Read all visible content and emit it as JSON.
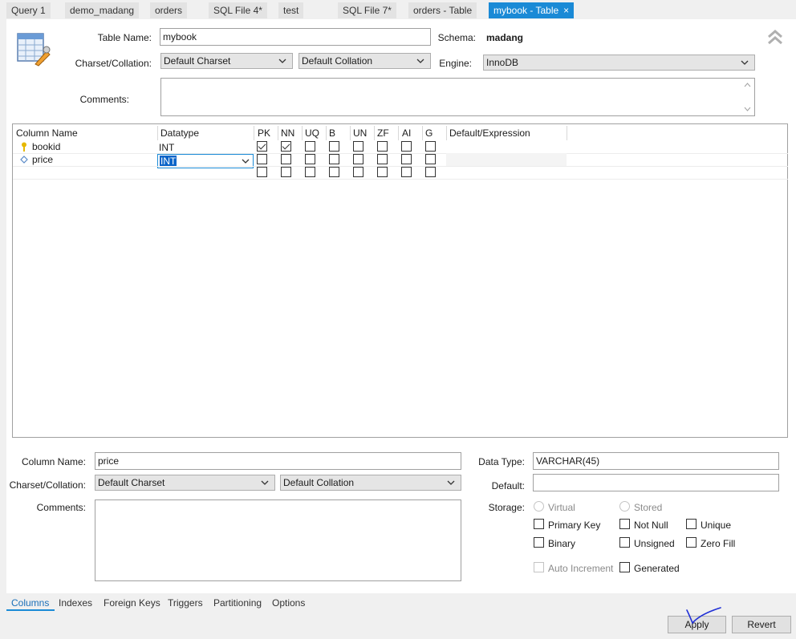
{
  "tabs": [
    {
      "label": "Query 1"
    },
    {
      "label": "demo_madang"
    },
    {
      "label": "orders"
    },
    {
      "label": "SQL File 4*"
    },
    {
      "label": "test"
    },
    {
      "label": "SQL File 7*"
    },
    {
      "label": "orders - Table"
    },
    {
      "label": "mybook - Table",
      "active": true
    }
  ],
  "table": {
    "name_label": "Table Name:",
    "name_value": "mybook",
    "schema_label": "Schema:",
    "schema_value": "madang",
    "charset_label": "Charset/Collation:",
    "charset_value": "Default Charset",
    "collation_value": "Default Collation",
    "engine_label": "Engine:",
    "engine_value": "InnoDB",
    "comments_label": "Comments:"
  },
  "grid": {
    "headers": [
      "Column Name",
      "Datatype",
      "PK",
      "NN",
      "UQ",
      "B",
      "UN",
      "ZF",
      "AI",
      "G",
      "Default/Expression"
    ],
    "rows": [
      {
        "name": "bookid",
        "type": "INT",
        "pk": true,
        "nn": true
      },
      {
        "name": "price",
        "type": "INT",
        "pk": false,
        "nn": false
      }
    ]
  },
  "column": {
    "name_label": "Column Name:",
    "name_value": "price",
    "charset_label": "Charset/Collation:",
    "charset_value": "Default Charset",
    "collation_value": "Default Collation",
    "comments_label": "Comments:",
    "datatype_label": "Data Type:",
    "datatype_value": "VARCHAR(45)",
    "default_label": "Default:",
    "storage_label": "Storage:",
    "virtual": "Virtual",
    "stored": "Stored",
    "primary_key": "Primary Key",
    "not_null": "Not Null",
    "unique": "Unique",
    "binary": "Binary",
    "unsigned": "Unsigned",
    "zero_fill": "Zero Fill",
    "auto_increment": "Auto Increment",
    "generated": "Generated"
  },
  "bottom_tabs": [
    "Columns",
    "Indexes",
    "Foreign Keys",
    "Triggers",
    "Partitioning",
    "Options"
  ],
  "buttons": {
    "apply": "Apply",
    "revert": "Revert"
  },
  "colors": {
    "accent": "#1a8ad6",
    "active_tab_text": "#1a6fb8"
  }
}
